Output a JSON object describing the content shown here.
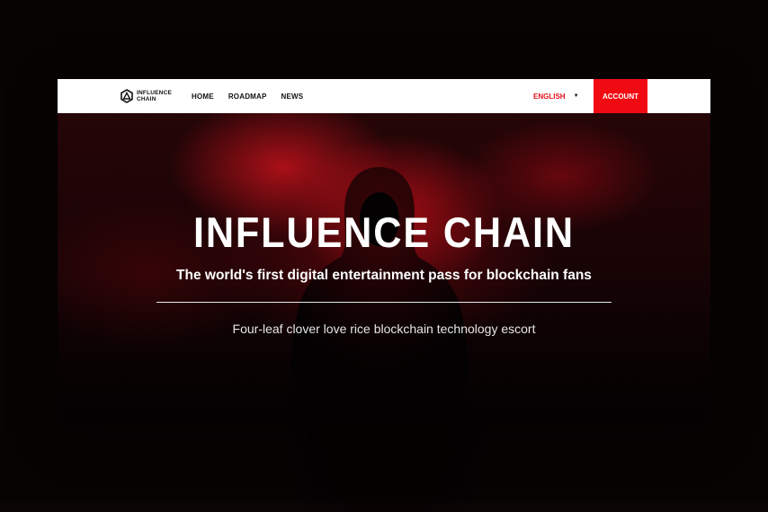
{
  "brand": {
    "logo_line1": "INFLUENCE",
    "logo_line2": "CHAIN"
  },
  "nav": {
    "links": [
      "HOME",
      "ROADMAP",
      "NEWS"
    ],
    "language": "ENGLISH",
    "account_label": "ACCOUNT"
  },
  "hero": {
    "title": "INFLUENCE CHAIN",
    "subtitle": "The world's first digital entertainment pass for blockchain fans",
    "tagline": "Four-leaf clover love rice blockchain technology escort"
  },
  "colors": {
    "accent": "#f00a12",
    "language_text": "#e3111b",
    "nav_bg": "#ffffff"
  },
  "icons": {
    "logo": "hexagon-logo-icon",
    "language_caret": "caret-down-icon"
  }
}
